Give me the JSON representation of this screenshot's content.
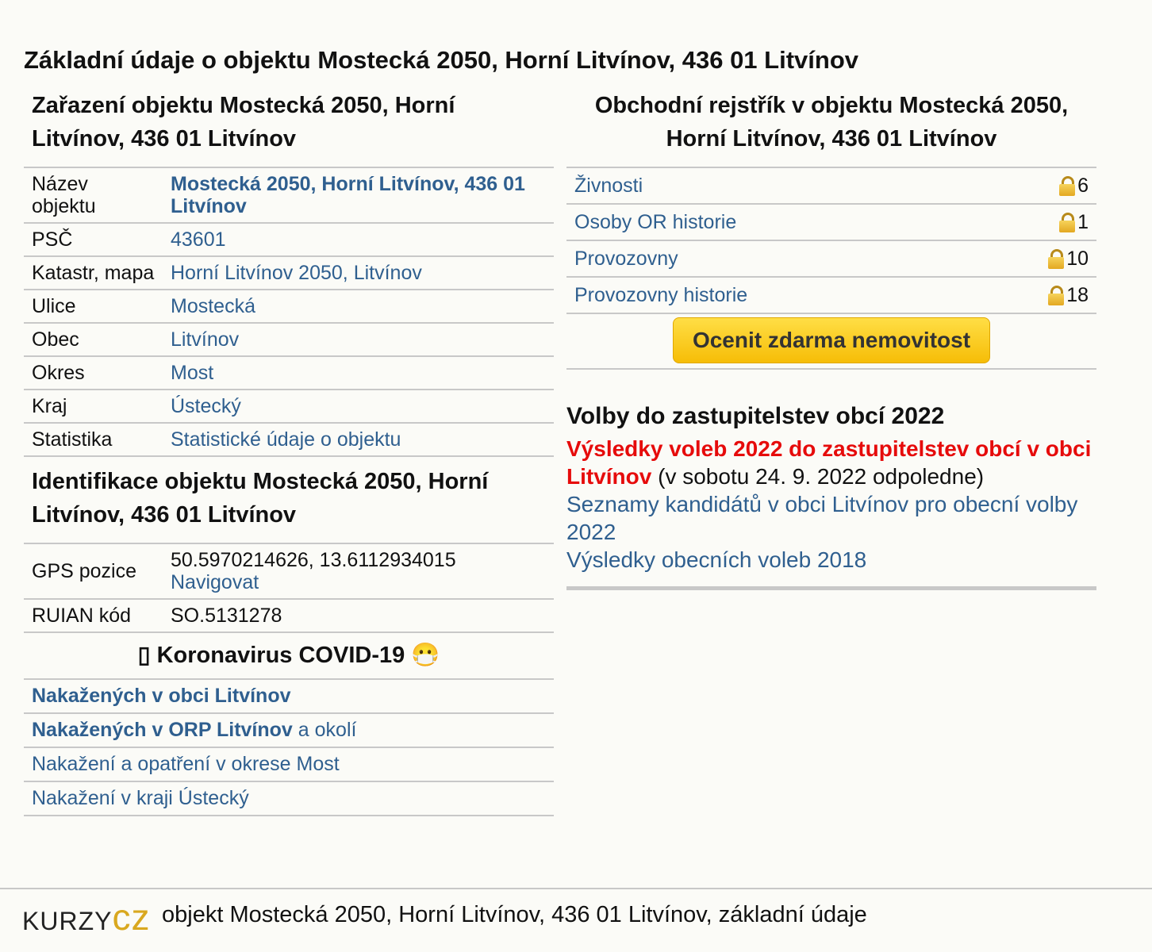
{
  "title": "Základní údaje o objektu Mostecká 2050, Horní Litvínov, 436 01 Litvínov",
  "classification": {
    "heading": "Zařazení objektu Mostecká 2050, Horní Litvínov, 436 01 Litvínov",
    "rows": [
      {
        "label": "Název objektu",
        "value": "Mostecká 2050, Horní Litvínov, 436 01 Litvínov"
      },
      {
        "label": "PSČ",
        "value": "43601"
      },
      {
        "label": "Katastr, mapa",
        "value": "Horní Litvínov 2050, Litvínov"
      },
      {
        "label": "Ulice",
        "value": "Mostecká"
      },
      {
        "label": "Obec",
        "value": "Litvínov"
      },
      {
        "label": "Okres",
        "value": "Most"
      },
      {
        "label": "Kraj",
        "value": "Ústecký"
      },
      {
        "label": "Statistika",
        "value": "Statistické údaje o objektu"
      }
    ]
  },
  "identification": {
    "heading": "Identifikace objektu Mostecká 2050, Horní Litvínov, 436 01 Litvínov",
    "gps_label": "GPS pozice",
    "gps_value": "50.5970214626, 13.6112934015",
    "navigate_link": "Navigovat",
    "ruian_label": "RUIAN kód",
    "ruian_value": "SO.5131278"
  },
  "covid": {
    "title": "Koronavirus COVID-19",
    "title_prefix_glyph": "▯",
    "title_emoji": "😷",
    "links": {
      "obec": "Nakažených v obci Litvínov",
      "orp": "Nakažených v ORP Litvínov",
      "orp_suffix": "a okolí",
      "okres": "Nakažení a opatření v okrese Most",
      "kraj": "Nakažení v kraji Ústecký"
    }
  },
  "business_register": {
    "heading": "Obchodní rejstřík v objektu Mostecká 2050, Horní Litvínov, 436 01 Litvínov",
    "rows": [
      {
        "label": "Živnosti",
        "count": "6",
        "icon": "lock-icon"
      },
      {
        "label": "Osoby OR historie",
        "count": "1",
        "icon": "lock-icon"
      },
      {
        "label": "Provozovny",
        "count": "10",
        "icon": "lock-icon"
      },
      {
        "label": "Provozovny historie",
        "count": "18",
        "icon": "lock-icon"
      }
    ],
    "button_label": "Ocenit zdarma nemovitost"
  },
  "elections": {
    "heading": "Volby do zastupitelstev obcí 2022",
    "results_link": "Výsledky voleb 2022 do zastupitelstev obcí v obci Litvínov",
    "results_note": "(v sobotu 24. 9. 2022 odpoledne)",
    "candidates_link": "Seznamy kandidátů v obci Litvínov pro obecní volby 2022",
    "results_2018_link": "Výsledky obecních voleb 2018"
  },
  "footer": {
    "logo_part1": "KURZY",
    "logo_part2": "CZ",
    "text": "objekt Mostecká 2050, Horní Litvínov, 436 01 Litvínov, základní údaje"
  },
  "colors": {
    "link": "#2f5f8f",
    "highlight_red": "#e60b0b",
    "button": "#f6bd07",
    "background": "#fbfbf7"
  }
}
